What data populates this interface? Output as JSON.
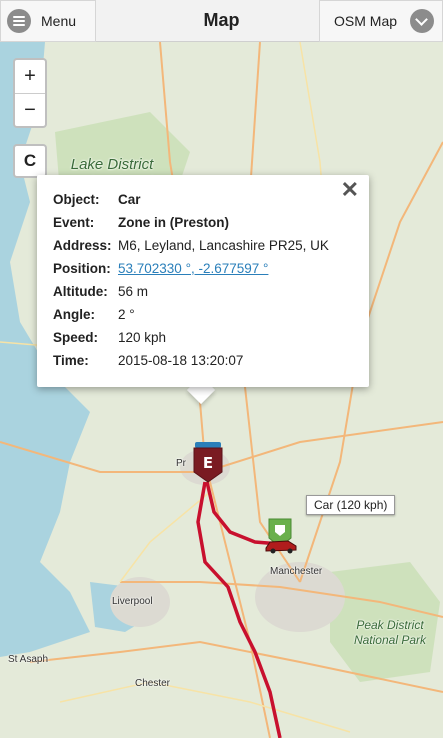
{
  "header": {
    "menu_label": "Menu",
    "title": "Map",
    "map_type_label": "OSM Map",
    "menu_icon": "hamburger-icon",
    "dropdown_icon": "chevron-down-icon"
  },
  "map_controls": {
    "zoom_in": "+",
    "zoom_out": "−",
    "center": "C"
  },
  "map_labels": {
    "lake_district": "Lake District National Park",
    "peak_district": "Peak District National Park",
    "towns": [
      "Pr",
      "Manchester",
      "Liverpool",
      "St Asaph",
      "Chester"
    ]
  },
  "popup": {
    "close_label": "✕",
    "rows": [
      {
        "key": "Object:",
        "value": "Car"
      },
      {
        "key": "Event:",
        "value": "Zone in (Preston)"
      },
      {
        "key": "Address:",
        "value": "M6, Leyland, Lancashire PR25, UK"
      },
      {
        "key": "Position:",
        "value": "53.702330 °, -2.677597 °"
      },
      {
        "key": "Altitude:",
        "value": "56 m"
      },
      {
        "key": "Angle:",
        "value": "2 °"
      },
      {
        "key": "Speed:",
        "value": "120 kph"
      },
      {
        "key": "Time:",
        "value": "2015-08-18 13:20:07"
      }
    ]
  },
  "markers": {
    "event_letter": "E",
    "car_label": "Car (120 kph)"
  },
  "colors": {
    "route": "#c8102e",
    "event_marker": "#7a1b22",
    "start_marker": "#6ab04c",
    "link": "#2a7fba"
  }
}
